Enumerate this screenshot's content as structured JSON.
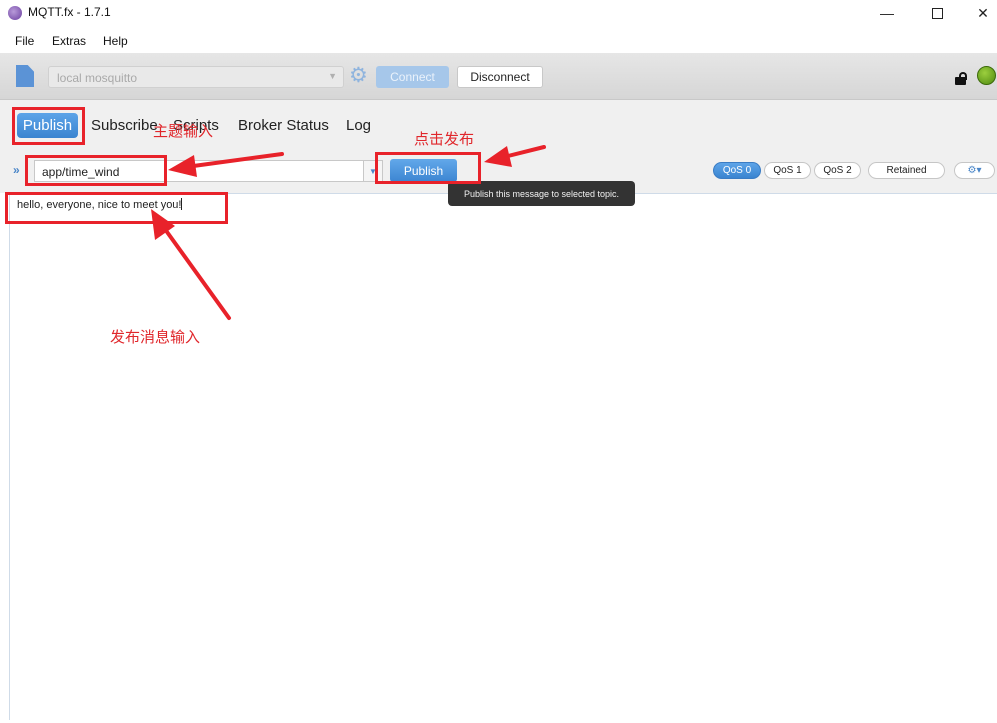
{
  "window": {
    "title": "MQTT.fx - 1.7.1",
    "minimize_glyph": "—",
    "close_glyph": "✕"
  },
  "menu": [
    "File",
    "Extras",
    "Help"
  ],
  "connection": {
    "profile": "local mosquitto",
    "connect_label": "Connect",
    "disconnect_label": "Disconnect",
    "status_color": "#6aa51f"
  },
  "tabs": [
    "Publish",
    "Subscribe",
    "Scripts",
    "Broker Status",
    "Log"
  ],
  "publish": {
    "topic": "app/time_wind",
    "button_label": "Publish",
    "tooltip": "Publish this message to selected topic.",
    "qos": [
      "QoS 0",
      "QoS 1",
      "QoS 2"
    ],
    "qos_selected": "QoS 0",
    "retained_label": "Retained",
    "message": "hello, everyone, nice to meet you!"
  },
  "annotations": {
    "topic_note": "主题输入",
    "click_note": "点击发布",
    "message_note": "发布消息输入",
    "color": "#e8222a"
  }
}
